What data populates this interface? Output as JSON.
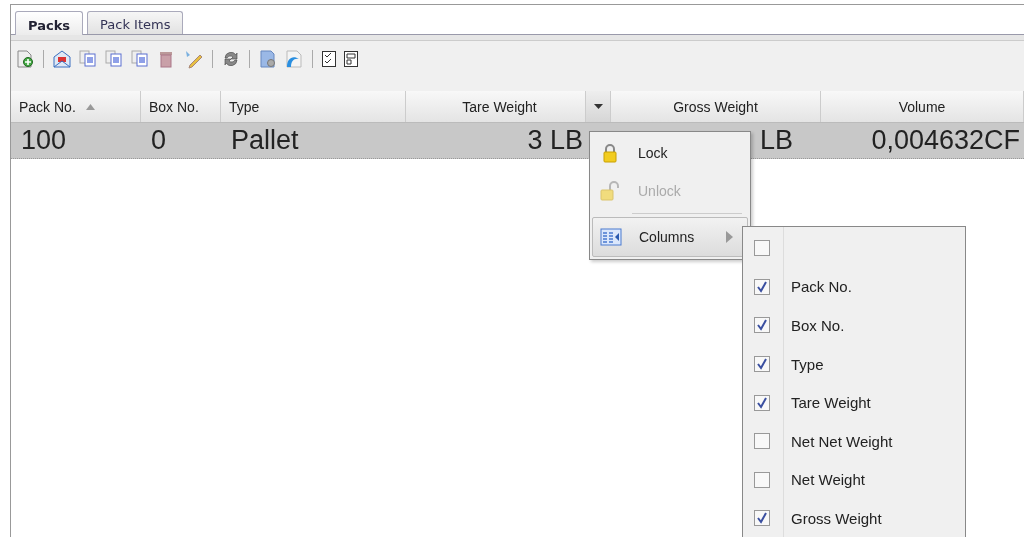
{
  "tabs": [
    {
      "label": "Packs",
      "selected": true
    },
    {
      "label": "Pack Items",
      "selected": false
    }
  ],
  "toolbar": [
    {
      "kind": "new"
    },
    {
      "kind": "sep"
    },
    {
      "kind": "mail"
    },
    {
      "kind": "doc"
    },
    {
      "kind": "doc"
    },
    {
      "kind": "doc"
    },
    {
      "kind": "trash"
    },
    {
      "kind": "edit"
    },
    {
      "kind": "sep"
    },
    {
      "kind": "refresh"
    },
    {
      "kind": "sep"
    },
    {
      "kind": "settings"
    },
    {
      "kind": "swoosh"
    },
    {
      "kind": "sep"
    },
    {
      "kind": "checklist"
    },
    {
      "kind": "form"
    }
  ],
  "table": {
    "columns": [
      {
        "label": "Pack No.",
        "sorted": true,
        "menu_open": false
      },
      {
        "label": "Box No.",
        "sorted": false,
        "menu_open": false
      },
      {
        "label": "Type",
        "sorted": false,
        "menu_open": false
      },
      {
        "label": "Tare Weight",
        "sorted": false,
        "menu_open": true
      },
      {
        "label": "Gross Weight",
        "sorted": false,
        "menu_open": false
      },
      {
        "label": "Volume",
        "sorted": false,
        "menu_open": false
      }
    ],
    "rows": [
      {
        "selected": true,
        "cells": [
          "100",
          "0",
          "Pallet",
          "3 LB",
          "LB",
          "0,004632CF"
        ]
      }
    ]
  },
  "column_menu": {
    "items": [
      {
        "kind": "lock",
        "label": "Lock",
        "disabled": false
      },
      {
        "kind": "unlock",
        "label": "Unlock",
        "disabled": true
      },
      {
        "kind": "sep"
      },
      {
        "kind": "submenu",
        "label": "Columns",
        "expanded": true
      }
    ]
  },
  "columns_submenu": [
    {
      "checked": false
    },
    {
      "label": "Pack No.",
      "checked": true
    },
    {
      "label": "Box No.",
      "checked": true
    },
    {
      "label": "Type",
      "checked": true
    },
    {
      "label": "Tare Weight",
      "checked": true
    },
    {
      "label": "Net Net Weight",
      "checked": false
    },
    {
      "label": "Net Weight",
      "checked": false
    },
    {
      "label": "Gross Weight",
      "checked": true
    }
  ]
}
